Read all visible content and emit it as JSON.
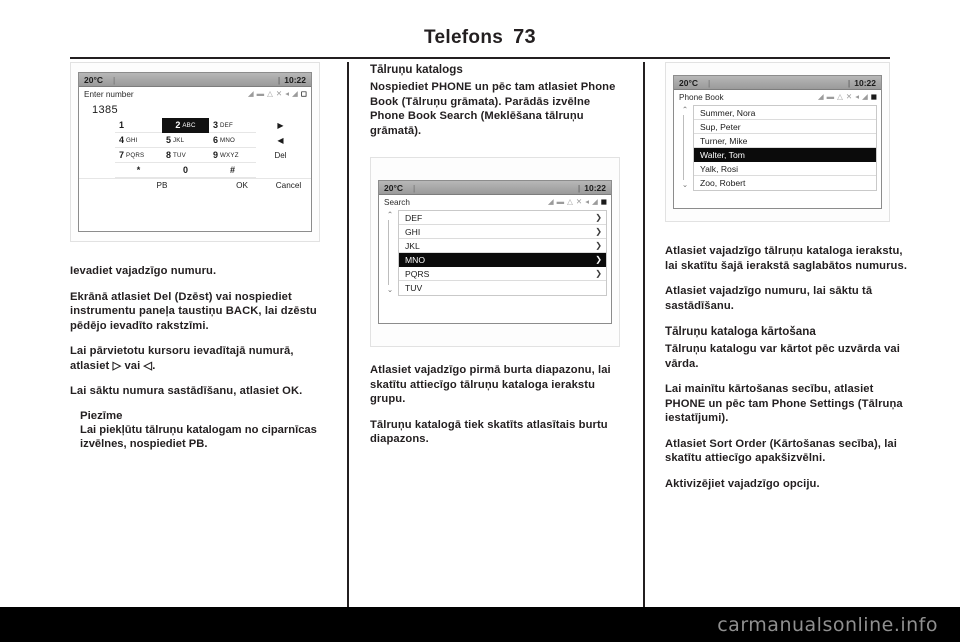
{
  "header": {
    "title": "Telefons",
    "page_number": "73"
  },
  "watermark": {
    "text": "carmanualsonline.info"
  },
  "screens": {
    "dialpad": {
      "temperature": "20°C",
      "clock": "10:22",
      "title": "Enter number",
      "entered_number": "1385",
      "keys": [
        {
          "num": "1",
          "letters": ""
        },
        {
          "num": "2",
          "letters": "ABC"
        },
        {
          "num": "3",
          "letters": "DEF"
        },
        {
          "num": "4",
          "letters": "GHI"
        },
        {
          "num": "5",
          "letters": "JKL"
        },
        {
          "num": "6",
          "letters": "MNO"
        },
        {
          "num": "7",
          "letters": "PQRS"
        },
        {
          "num": "8",
          "letters": "TUV"
        },
        {
          "num": "9",
          "letters": "WXYZ"
        },
        {
          "num": "*",
          "letters": ""
        },
        {
          "num": "0",
          "letters": ""
        },
        {
          "num": "#",
          "letters": ""
        }
      ],
      "selected_key": "2 ABC",
      "side_keys": [
        "▶",
        "◀",
        "Del"
      ],
      "bottom_keys": {
        "pb": "PB",
        "ok": "OK",
        "cancel": "Cancel"
      },
      "status_icons": [
        "wifi-icon",
        "sim-icon",
        "bluetooth-icon",
        "shuffle-icon",
        "mute-icon",
        "phone-icon",
        "battery-icon"
      ]
    },
    "search": {
      "temperature": "20°C",
      "clock": "10:22",
      "title": "Search",
      "rows": [
        {
          "label": "DEF",
          "chevron": "❯",
          "selected": false
        },
        {
          "label": "GHI",
          "chevron": "❯",
          "selected": false
        },
        {
          "label": "JKL",
          "chevron": "❯",
          "selected": false
        },
        {
          "label": "MNO",
          "chevron": "❯",
          "selected": true
        },
        {
          "label": "PQRS",
          "chevron": "❯",
          "selected": false
        },
        {
          "label": "TUV",
          "chevron": "",
          "selected": false
        }
      ],
      "scroll_up": "⌃",
      "scroll_down": "⌄",
      "status_icons": [
        "wifi-icon",
        "sim-icon",
        "bluetooth-icon",
        "shuffle-icon",
        "mute-icon",
        "phone-icon",
        "battery-icon"
      ]
    },
    "phonebook": {
      "temperature": "20°C",
      "clock": "10:22",
      "title": "Phone Book",
      "rows": [
        {
          "label": "Summer, Nora",
          "selected": false
        },
        {
          "label": "Sup, Peter",
          "selected": false
        },
        {
          "label": "Turner, Mike",
          "selected": false
        },
        {
          "label": "Walter, Tom",
          "selected": true
        },
        {
          "label": "Yalk, Rosi",
          "selected": false
        },
        {
          "label": "Zoo, Robert",
          "selected": false
        }
      ],
      "scroll_up": "⌃",
      "scroll_down": "⌄",
      "status_icons": [
        "wifi-icon",
        "sim-icon",
        "bluetooth-icon",
        "shuffle-icon",
        "mute-icon",
        "phone-icon",
        "battery-icon"
      ]
    }
  },
  "column1": {
    "p1": "Ievadiet vajadzīgo numuru.",
    "p2": "Ekrānā atlasiet Del (Dzēst) vai nospiediet instrumentu paneļa taustiņu BACK, lai dzēstu pēdējo ievadīto rakstzīmi.",
    "p3": "Lai pārvietotu kursoru ievadītajā numurā, atlasiet ▷ vai ◁.",
    "p4": "Lai sāktu numura sastādīšanu, atlasiet OK.",
    "note_title": "Piezīme",
    "note_body": "Lai piekļūtu tālruņu katalogam no ciparnīcas izvēlnes, nospiediet PB."
  },
  "column2": {
    "heading": "Tālruņu katalogs",
    "p1": "Nospiediet PHONE un pēc tam atlasiet Phone Book (Tālruņu grāmata). Parādās izvēlne Phone Book Search (Meklēšana tālruņu grāmatā).",
    "p2": "Atlasiet vajadzīgo pirmā burta diapazonu, lai skatītu attiecīgo tālruņu kataloga ierakstu grupu.",
    "p3": "Tālruņu katalogā tiek skatīts atlasītais burtu diapazons."
  },
  "column3": {
    "p1": "Atlasiet vajadzīgo tālruņu kataloga ierakstu, lai skatītu šajā ierakstā saglabātos numurus.",
    "p2": "Atlasiet vajadzīgo numuru, lai sāktu tā sastādīšanu.",
    "heading": "Tālruņu kataloga kārtošana",
    "p3": "Tālruņu katalogu var kārtot pēc uzvārda vai vārda.",
    "p4": "Lai mainītu kārtošanas secību, atlasiet PHONE un pēc tam Phone Settings (Tālruņa iestatījumi).",
    "p5": "Atlasiet Sort Order (Kārtošanas secība), lai skatītu attiecīgo apakšizvēlni.",
    "p6": "Aktivizējiet vajadzīgo opciju."
  }
}
